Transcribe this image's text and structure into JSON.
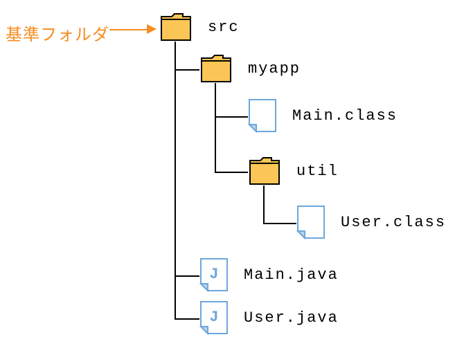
{
  "annotation": {
    "label": "基準フォルダ"
  },
  "tree": {
    "src": {
      "name": "src",
      "type": "folder"
    },
    "myapp": {
      "name": "myapp",
      "type": "folder"
    },
    "main_class": {
      "name": "Main.class",
      "type": "class"
    },
    "util": {
      "name": "util",
      "type": "folder"
    },
    "user_class": {
      "name": "User.class",
      "type": "class"
    },
    "main_java": {
      "name": "Main.java",
      "type": "java"
    },
    "user_java": {
      "name": "User.java",
      "type": "java"
    }
  },
  "colors": {
    "accent": "#f68c1f",
    "folder_fill": "#fcc656",
    "file_stroke": "#6da6db",
    "file_fill": "#ffffff"
  }
}
